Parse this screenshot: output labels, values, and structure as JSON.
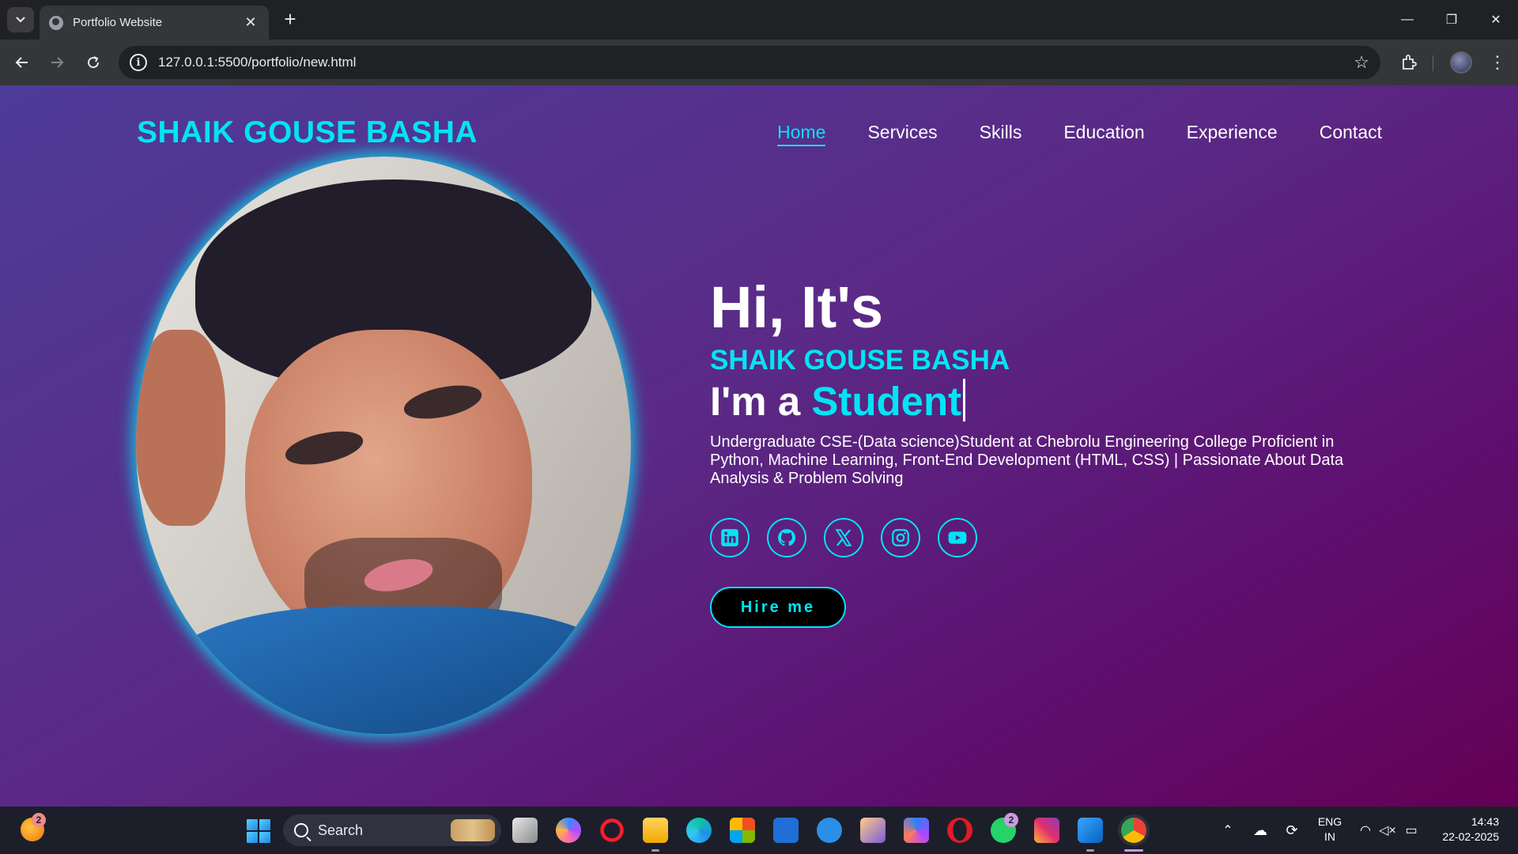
{
  "browser": {
    "tab_title": "Portfolio Website",
    "tab_close": "✕",
    "new_tab": "+",
    "url": "127.0.0.1:5500/portfolio/new.html",
    "window_controls": {
      "minimize": "—",
      "restore": "❐",
      "close": "✕"
    }
  },
  "site": {
    "logo": "SHAIK GOUSE BASHA",
    "nav": [
      "Home",
      "Services",
      "Skills",
      "Education",
      "Experience",
      "Contact"
    ],
    "active_nav": "Home",
    "accent_color": "#00e5f5"
  },
  "hero": {
    "greeting": "Hi, It's",
    "name": "SHAIK GOUSE BASHA",
    "role_prefix": "I'm a ",
    "role_highlight": "Student",
    "description": "Undergraduate CSE-(Data science)Student at Chebrolu Engineering College Proficient in Python, Machine Learning, Front-End Development (HTML, CSS) | Passionate About Data Analysis & Problem Solving",
    "socials": [
      "linkedin-icon",
      "github-icon",
      "x-icon",
      "instagram-icon",
      "youtube-icon"
    ],
    "cta": "Hire me"
  },
  "taskbar": {
    "search_label": "Search",
    "weather_badge": "2",
    "whatsapp_badge": "2",
    "language": "ENG",
    "region": "IN",
    "time": "14:43",
    "date": "22-02-2025"
  }
}
